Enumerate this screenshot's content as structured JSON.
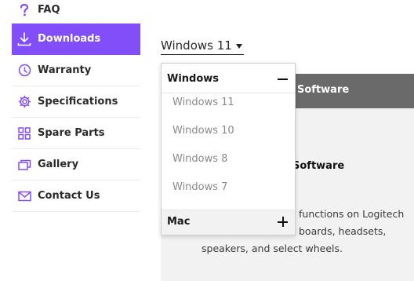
{
  "sidebar": {
    "items": [
      {
        "label": "FAQ",
        "icon": "question-icon"
      },
      {
        "label": "Downloads",
        "icon": "download-icon",
        "active": true
      },
      {
        "label": "Warranty",
        "icon": "warranty-icon"
      },
      {
        "label": "Specifications",
        "icon": "gear-icon"
      },
      {
        "label": "Spare Parts",
        "icon": "grid-icon"
      },
      {
        "label": "Gallery",
        "icon": "gallery-icon"
      },
      {
        "label": "Contact Us",
        "icon": "mail-icon"
      }
    ]
  },
  "version_select": {
    "value": "Windows 11"
  },
  "dropdown": {
    "windows_group": "Windows",
    "windows_options": [
      "Windows 11",
      "Windows 10",
      "Windows 8",
      "Windows 7"
    ],
    "mac_group": "Mac"
  },
  "panel": {
    "header_title": "Software",
    "software_title": "Software",
    "description": "functions on Logitech\n      boards, headsets,\nspeakers, and select wheels.",
    "desc_lines": [
      "functions on Logitech",
      "boards, headsets,",
      "speakers, and select wheels."
    ]
  },
  "colors": {
    "accent": "#814efa",
    "panel_header": "#6a6a6a",
    "panel_bg": "#f2f2f2"
  }
}
